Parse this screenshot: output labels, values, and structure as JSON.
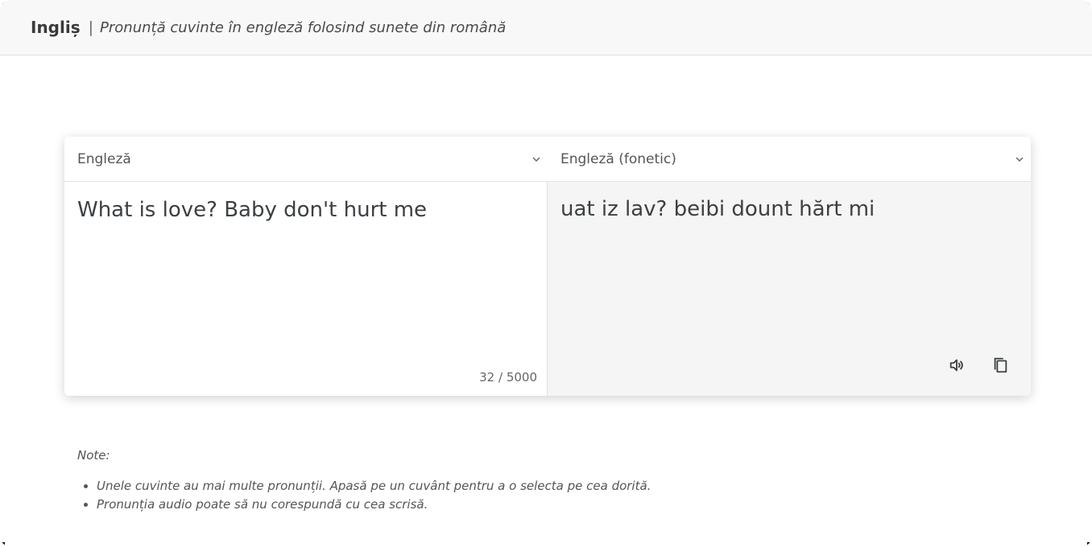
{
  "header": {
    "brand": "Ingliș",
    "separator": "|",
    "tagline": "Pronunță cuvinte în engleză folosind sunete din română"
  },
  "translator": {
    "source_language": "Engleză",
    "target_language": "Engleză (fonetic)",
    "source_text": "What is love? Baby don't hurt me",
    "char_counter": "32 / 5000",
    "result_text": "uat iz lav? beibi dount hărt mi",
    "icons": {
      "dropdown": "chevron-down-icon",
      "speak": "speaker-icon",
      "copy": "copy-icon"
    }
  },
  "notes": {
    "title": "Note:",
    "items": [
      "Unele cuvinte au mai multe pronunții. Apasă pe un cuvânt pentru a o selecta pe cea dorită.",
      "Pronunția audio poate să nu corespundă cu cea scrisă."
    ]
  }
}
